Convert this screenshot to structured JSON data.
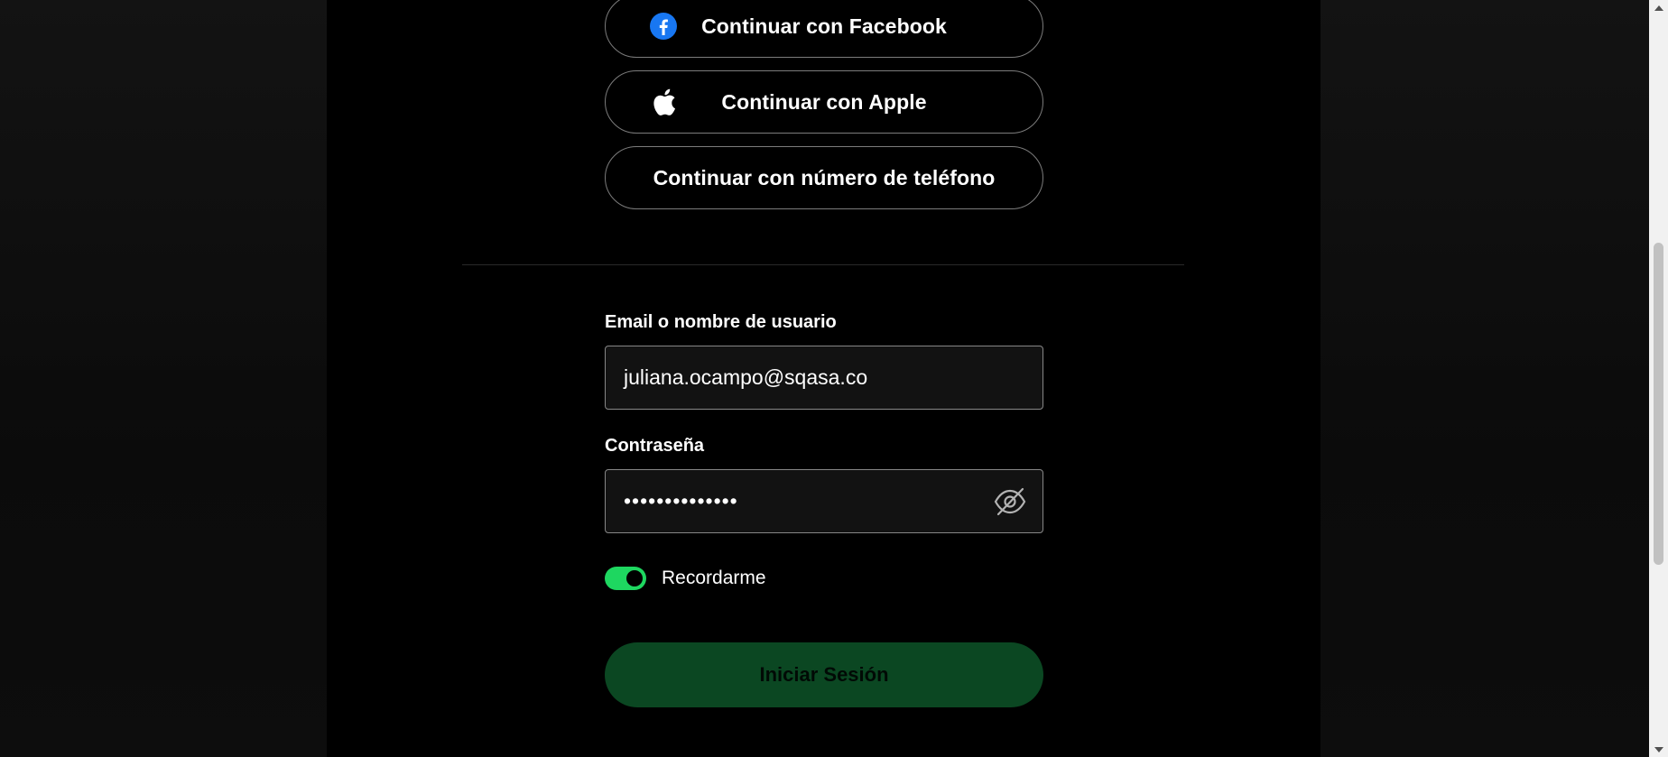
{
  "social_login": {
    "facebook": {
      "label": "Continuar con Facebook",
      "icon": "facebook-icon",
      "icon_color": "#1877f2"
    },
    "apple": {
      "label": "Continuar con Apple",
      "icon": "apple-icon"
    },
    "phone": {
      "label": "Continuar con número de teléfono"
    }
  },
  "login_form": {
    "email": {
      "label": "Email o nombre de usuario",
      "value": "juliana.ocampo@sqasa.co"
    },
    "password": {
      "label": "Contraseña",
      "masked_value": "••••••••••••••",
      "toggle_icon": "eye-slash-icon"
    },
    "remember": {
      "label": "Recordarme",
      "checked": true,
      "color": "#1ed760"
    },
    "submit": {
      "label": "Iniciar Sesión",
      "color": "#0b4722"
    }
  },
  "scrollbar": {
    "up_icon": "scroll-up-arrow-icon",
    "down_icon": "scroll-down-arrow-icon"
  }
}
